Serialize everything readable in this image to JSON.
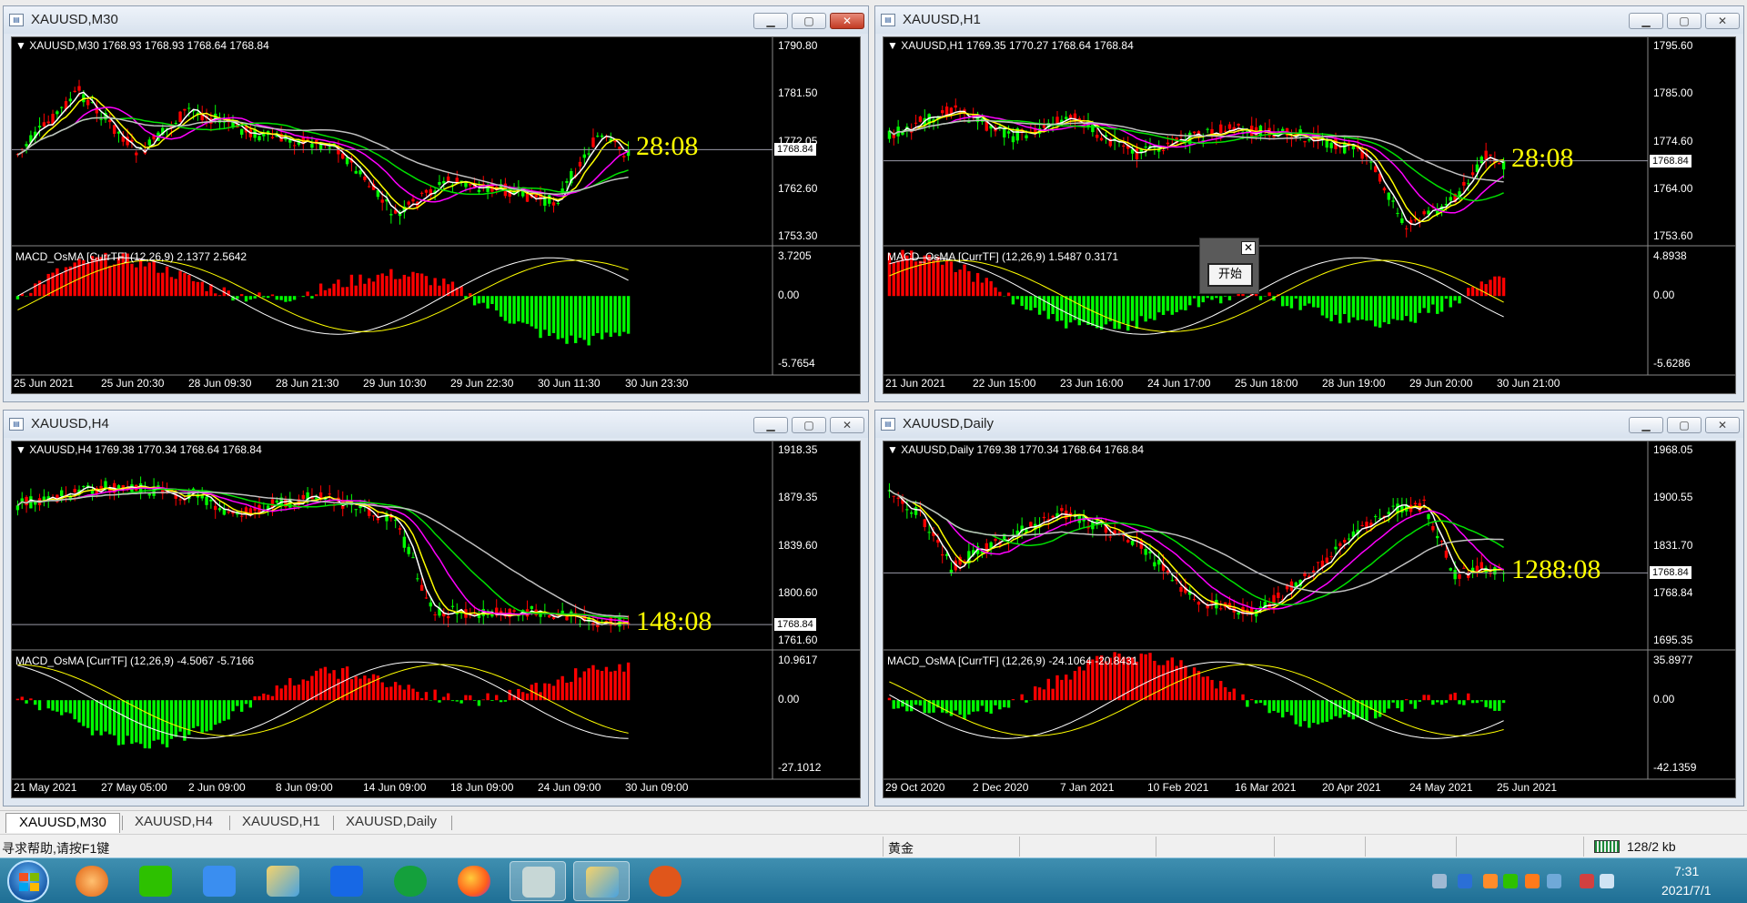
{
  "windows": [
    {
      "id": "m30",
      "title": "XAUUSD,M30",
      "info": "XAUUSD,M30  1768.93 1768.93 1768.64 1768.84",
      "macd_label": "MACD_OsMA [CurrTF] (12,26,9) 2.1377 2.5642",
      "timer": "28:08",
      "price_ticks": [
        "1790.80",
        "1781.50",
        "1772.05",
        "1762.60",
        "1753.30"
      ],
      "current_price": "1768.84",
      "macd_ticks": [
        "3.7205",
        "0.00",
        "-5.7654"
      ],
      "time_labels": [
        "25 Jun 2021",
        "25 Jun 20:30",
        "28 Jun 09:30",
        "28 Jun 21:30",
        "29 Jun 10:30",
        "29 Jun 22:30",
        "30 Jun 11:30",
        "30 Jun 23:30"
      ]
    },
    {
      "id": "h1",
      "title": "XAUUSD,H1",
      "info": "XAUUSD,H1  1769.35 1770.27 1768.64 1768.84",
      "macd_label": "MACD_OsMA [CurrTF] (12,26,9) 1.5487 0.3171",
      "timer": "28:08",
      "price_ticks": [
        "1795.60",
        "1785.00",
        "1774.60",
        "1764.00",
        "1753.60"
      ],
      "current_price": "1768.84",
      "macd_ticks": [
        "4.8938",
        "0.00",
        "-5.6286"
      ],
      "time_labels": [
        "21 Jun 2021",
        "22 Jun 15:00",
        "23 Jun 16:00",
        "24 Jun 17:00",
        "25 Jun 18:00",
        "28 Jun 19:00",
        "29 Jun 20:00",
        "30 Jun 21:00"
      ]
    },
    {
      "id": "h4",
      "title": "XAUUSD,H4",
      "info": "XAUUSD,H4  1769.38 1770.34 1768.64 1768.84",
      "macd_label": "MACD_OsMA [CurrTF] (12,26,9) -4.5067 -5.7166",
      "timer": "148:08",
      "price_ticks": [
        "1918.35",
        "1879.35",
        "1839.60",
        "1800.60",
        "1761.60"
      ],
      "current_price": "1768.84",
      "macd_ticks": [
        "10.9617",
        "0.00",
        "-27.1012"
      ],
      "time_labels": [
        "21 May 2021",
        "27 May 05:00",
        "2 Jun 09:00",
        "8 Jun 09:00",
        "14 Jun 09:00",
        "18 Jun 09:00",
        "24 Jun 09:00",
        "30 Jun 09:00"
      ]
    },
    {
      "id": "daily",
      "title": "XAUUSD,Daily",
      "info": "XAUUSD,Daily  1769.38 1770.34 1768.64 1768.84",
      "macd_label": "MACD_OsMA [CurrTF] (12,26,9) -24.1064 -20.8431",
      "timer": "1288:08",
      "price_ticks": [
        "1968.05",
        "1900.55",
        "1831.70",
        "1768.84",
        "1695.35"
      ],
      "current_price": "1768.84",
      "macd_ticks": [
        "35.8977",
        "0.00",
        "-42.1359"
      ],
      "time_labels": [
        "29 Oct 2020",
        "2 Dec 2020",
        "7 Jan 2021",
        "10 Feb 2021",
        "16 Mar 2021",
        "20 Apr 2021",
        "24 May 2021",
        "25 Jun 2021"
      ]
    }
  ],
  "dialog": {
    "close": "✕",
    "button": "开始"
  },
  "tabs": [
    "XAUUSD,M30",
    "XAUUSD,H4",
    "XAUUSD,H1",
    "XAUUSD,Daily"
  ],
  "status": {
    "help": "寻求帮助,请按F1键",
    "symbol": "黄金",
    "traffic": "128/2 kb"
  },
  "clock": {
    "time": "7:31",
    "date": "2021/7/1"
  },
  "win_controls": {
    "min": "▁",
    "max": "▢",
    "close": "✕"
  },
  "colors": {
    "bull": "#00ff00",
    "bear": "#ff0000",
    "ma_fast": "#ffffff",
    "ma_yellow": "#ffff00",
    "ma_magenta": "#ff00ff",
    "ma_green": "#00e000",
    "ma_gray": "#c0c0c0",
    "timer": "#ffff00"
  }
}
